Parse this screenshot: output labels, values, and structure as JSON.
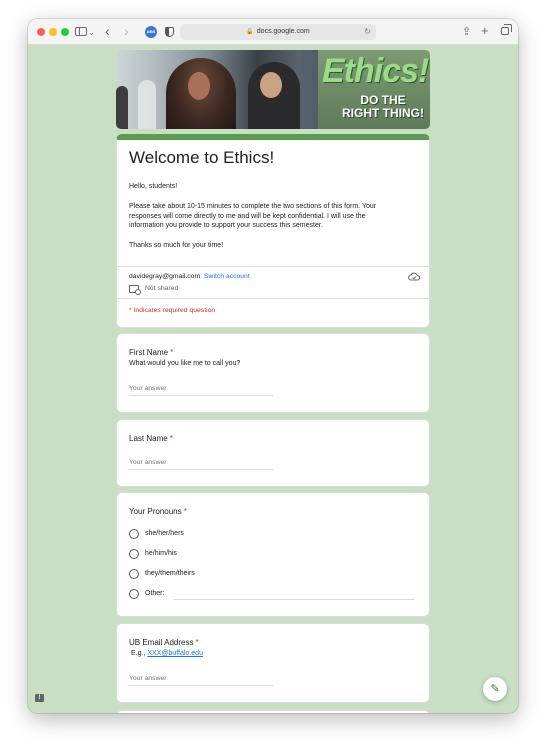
{
  "browser": {
    "url": "docs.google.com",
    "extension_badge": "ABB"
  },
  "banner": {
    "logo_word": "Ethics!",
    "logo_sub_line1": "DO THE",
    "logo_sub_line2": "RIGHT THING!"
  },
  "form": {
    "title": "Welcome to Ethics!",
    "greeting": "Hello, students!",
    "description_line1": "Please take about 10-15 minutes to complete the two sections of this form. Your",
    "description_line2": "responses will come directly to me and will be kept confidential. I will use the",
    "description_line3": "information you provide to support your success this semester.",
    "thanks": "Thanks so much for your time!",
    "account_email": "davidegray@gmail.com",
    "switch_account": "Switch account",
    "not_shared": "Not shared",
    "required_note": "* Indicates required question",
    "accent_color": "#5a9a55"
  },
  "questions": {
    "first_name": {
      "title": "First Name",
      "help": "What would you like me to call you?",
      "placeholder": "Your answer"
    },
    "last_name": {
      "title": "Last Name",
      "placeholder": "Your answer"
    },
    "pronouns": {
      "title": "Your Pronouns",
      "options": [
        "she/her/hers",
        "he/him/his",
        "they/them/theirs",
        "Other:"
      ]
    },
    "email": {
      "title": "UB Email Address",
      "help_prefix": "E.g., ",
      "help_link": "XXX@buffalo.edu",
      "placeholder": "Your answer"
    }
  },
  "required_star": "*",
  "feedback_glyph": "!"
}
